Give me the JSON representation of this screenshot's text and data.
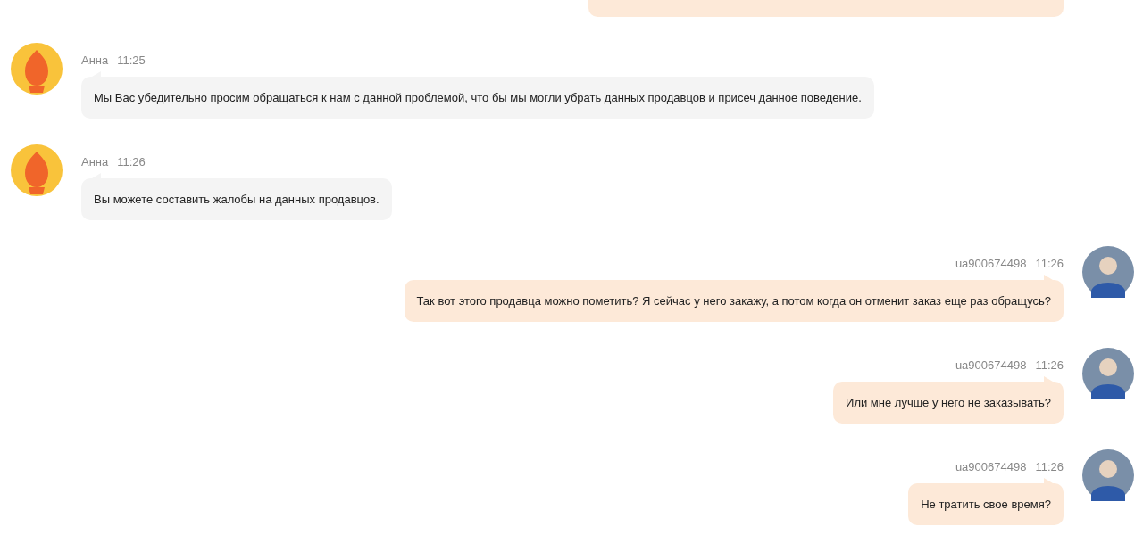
{
  "partial_message": {
    "kind": "user"
  },
  "messages": [
    {
      "kind": "agent",
      "author": "Анна",
      "time": "11:25",
      "text": "Мы Вас убедительно просим обращаться к нам с данной проблемой, что бы мы могли убрать данных продавцов и присеч данное поведение."
    },
    {
      "kind": "agent",
      "author": "Анна",
      "time": "11:26",
      "text": "Вы можете составить жалобы на данных продавцов."
    },
    {
      "kind": "user",
      "author": "ua900674498",
      "time": "11:26",
      "text": "Так вот этого продавца можно пометить? Я сейчас у него закажу, а потом когда он отменит заказ еще раз обращусь?"
    },
    {
      "kind": "user",
      "author": "ua900674498",
      "time": "11:26",
      "text": "Или мне лучше у него не заказывать?"
    },
    {
      "kind": "user",
      "author": "ua900674498",
      "time": "11:26",
      "text": "Не тратить свое время?"
    }
  ]
}
